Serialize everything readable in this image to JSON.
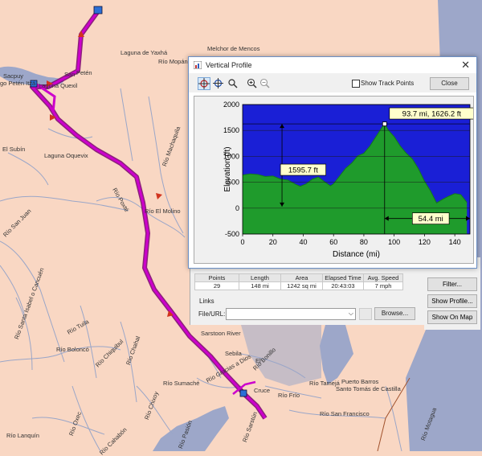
{
  "map": {
    "labels": [
      "Laguna de Yaxhá",
      "Melchor de Mencos",
      "Río Mopán",
      "Sacpuy",
      "go Petén Itzá",
      "Laguna Quexil",
      "San",
      "Petén",
      "El Subín",
      "Laguna Oquevix",
      "Río Machaquila",
      "Río Poxté",
      "Río El Molino",
      "Río San Juan",
      "Río Santa Isabel o Cancuén",
      "Río Tuila",
      "Río Boloncó",
      "Río Chahal",
      "Río Chiquibul",
      "Río Chixoy",
      "Río Cahabón",
      "Río Lanquín",
      "Río Oxec",
      "Sarstoon River",
      "Sebila",
      "Río Gracias a Dios",
      "Río Bonillo",
      "El",
      "Río Sumaché",
      "Cruce",
      "Río Frío",
      "Río Tamejá",
      "Puerto Barros",
      "Santo Tomás de Castilla",
      "Río San Francisco",
      "Río Motagua",
      "Río Sarstún",
      "Río Pasión"
    ],
    "colors": {
      "land": "#f9d7c3",
      "water": "#9da7c9",
      "river": "#9aa6c8",
      "route": "#cc00cc",
      "route_dark": "#7a0070",
      "arrow": "#d1341f"
    }
  },
  "dialog": {
    "title": "Vertical Profile",
    "toolbar_icons": [
      "crosshair-select-icon",
      "crosshair-pan-icon",
      "rotate-icon",
      "zoom-in-icon",
      "zoom-out-icon"
    ],
    "show_track_points_label": "Show Track Points",
    "show_track_points_checked": false,
    "close_label": "Close"
  },
  "panel": {
    "stats": {
      "headers": [
        "Points",
        "Length",
        "Area",
        "Elapsed Time",
        "Avg. Speed"
      ],
      "values": [
        "29",
        "148 mi",
        "1242 sq mi",
        "20:43:03",
        "7 mph"
      ]
    },
    "links_label": "Links",
    "file_url_label": "File/URL:",
    "file_url_value": "",
    "browse_label": "Browse...",
    "side_buttons": [
      "Filter...",
      "Show Profile...",
      "Show On Map"
    ]
  },
  "chart_data": {
    "type": "area",
    "xlabel": "Distance   (mi)",
    "ylabel": "Elevation (ft)",
    "xlim": [
      0,
      150
    ],
    "ylim": [
      -500,
      2000
    ],
    "x_ticks": [
      "0",
      "20",
      "40",
      "60",
      "80",
      "100",
      "120",
      "140"
    ],
    "y_ticks": [
      "-500",
      "0",
      "500",
      "1000",
      "1500",
      "2000"
    ],
    "x": [
      0,
      5,
      10,
      15,
      20,
      25,
      30,
      35,
      38,
      42,
      46,
      50,
      54,
      58,
      60,
      64,
      68,
      72,
      76,
      80,
      84,
      88,
      92,
      93.7,
      96,
      100,
      104,
      108,
      112,
      116,
      120,
      124,
      128,
      132,
      136,
      140,
      144,
      148
    ],
    "y": [
      640,
      660,
      650,
      610,
      620,
      560,
      540,
      460,
      420,
      470,
      560,
      600,
      510,
      430,
      470,
      620,
      770,
      870,
      1010,
      1060,
      1200,
      1380,
      1560,
      1626,
      1510,
      1380,
      1200,
      1060,
      950,
      760,
      520,
      330,
      100,
      170,
      230,
      280,
      260,
      110
    ],
    "colors": {
      "fill": "#1f9b2c",
      "sky": "#1a1fd6",
      "grid": "#1a1a1a"
    },
    "annotations": {
      "cursor_label": "93.7 mi, 1626.2 ft",
      "cursor_x": 93.7,
      "cursor_y": 1626.2,
      "vertical_label": "1595.7 ft",
      "horizontal_label": "54.4 mi"
    }
  }
}
